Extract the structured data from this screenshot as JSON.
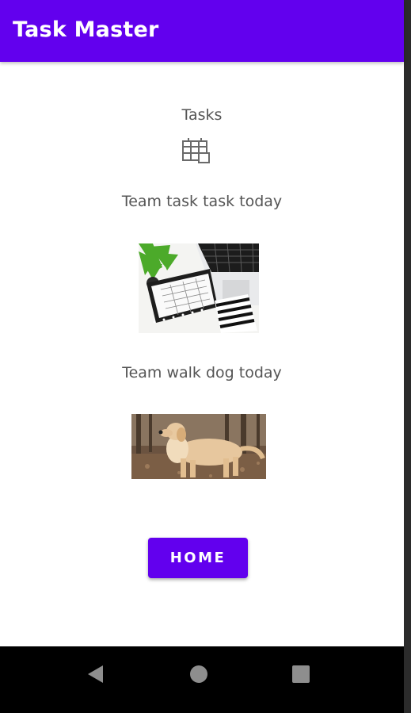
{
  "app_bar": {
    "title": "Task Master",
    "color": "#6200ee"
  },
  "main": {
    "heading": "Tasks",
    "heading_icon": "calendar-icon",
    "tasks": [
      {
        "title": "Team task task today",
        "image": "desk-planner-laptop-photo"
      },
      {
        "title": "Team walk dog today",
        "image": "golden-retriever-photo"
      }
    ],
    "home_button_label": "HOME"
  },
  "nav_bar": {
    "items": [
      "back-icon",
      "home-circle-icon",
      "recents-square-icon"
    ]
  }
}
